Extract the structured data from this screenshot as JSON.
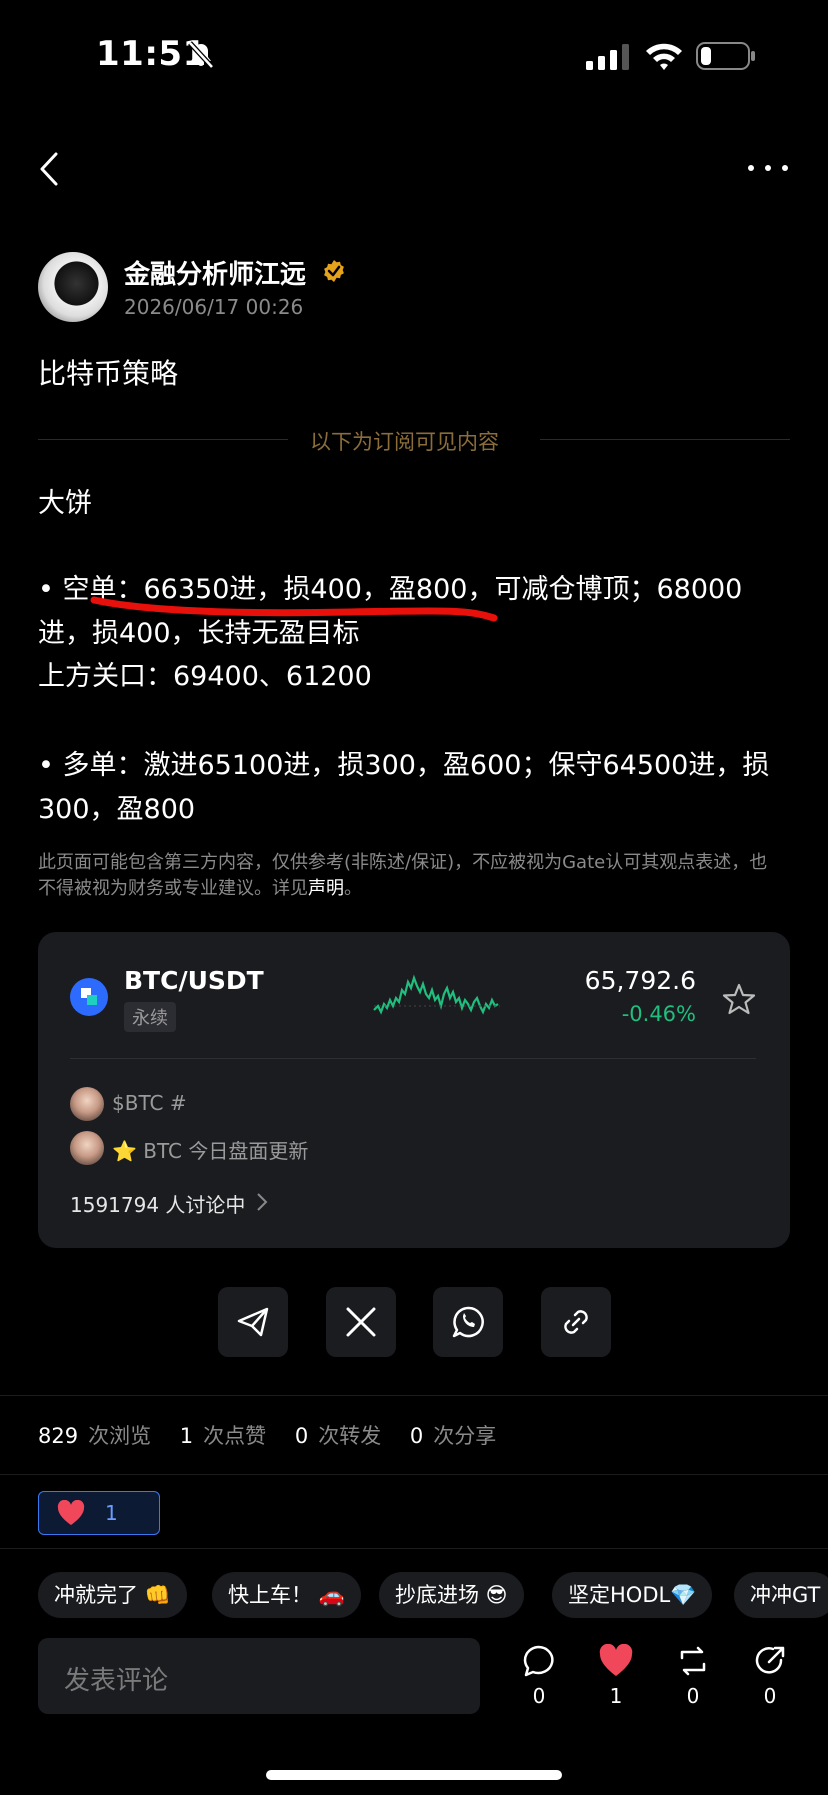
{
  "status_bar": {
    "time": "11:51"
  },
  "post": {
    "author": "金融分析师江远",
    "timestamp": "2026/06/17 00:26",
    "title": "比特币策略",
    "subscriber_divider": "以下为订阅可见内容",
    "body_lines": [
      "大饼",
      "• 空单：66350进，损400，盈800，可减仓博顶；68000",
      "进，损400，长持无盈目标",
      "上方关口：69400、61200",
      "• 多单：激进65100进，损300，盈600；保守64500进，损",
      "300，盈800"
    ],
    "disclaimer_text": "此页面可能包含第三方内容，仅供参考(非陈述/保证)，不应被视为Gate认可其观点表述，也不得被视为财务或专业建议。详见",
    "disclaimer_link": "声明",
    "disclaimer_end": "。"
  },
  "ticker_card": {
    "pair": "BTC/USDT",
    "type_tag": "永续",
    "price": "65,792.6",
    "change": "-0.46%",
    "up_color": "#1fbf7e",
    "topics": [
      "$BTC #",
      "BTC 今日盘面更新"
    ],
    "discussion": "1591794 人讨论中"
  },
  "share_buttons": [
    "telegram-icon",
    "x-icon",
    "whatsapp-icon",
    "link-icon"
  ],
  "stats": {
    "views": "829",
    "views_label": "次浏览",
    "likes": "1",
    "likes_label": "次点赞",
    "reposts": "0",
    "reposts_label": "次转发",
    "shares": "0",
    "shares_label": "次分享"
  },
  "reaction": {
    "count": "1"
  },
  "quick_replies": [
    "冲就完了 👊",
    "快上车！ 🚗",
    "抄底进场 😎",
    "坚定HODL💎",
    "冲冲GT"
  ],
  "comment_input": {
    "placeholder": "发表评论"
  },
  "actions": {
    "comments": "0",
    "likes": "1",
    "reposts": "0",
    "shares": "0"
  }
}
